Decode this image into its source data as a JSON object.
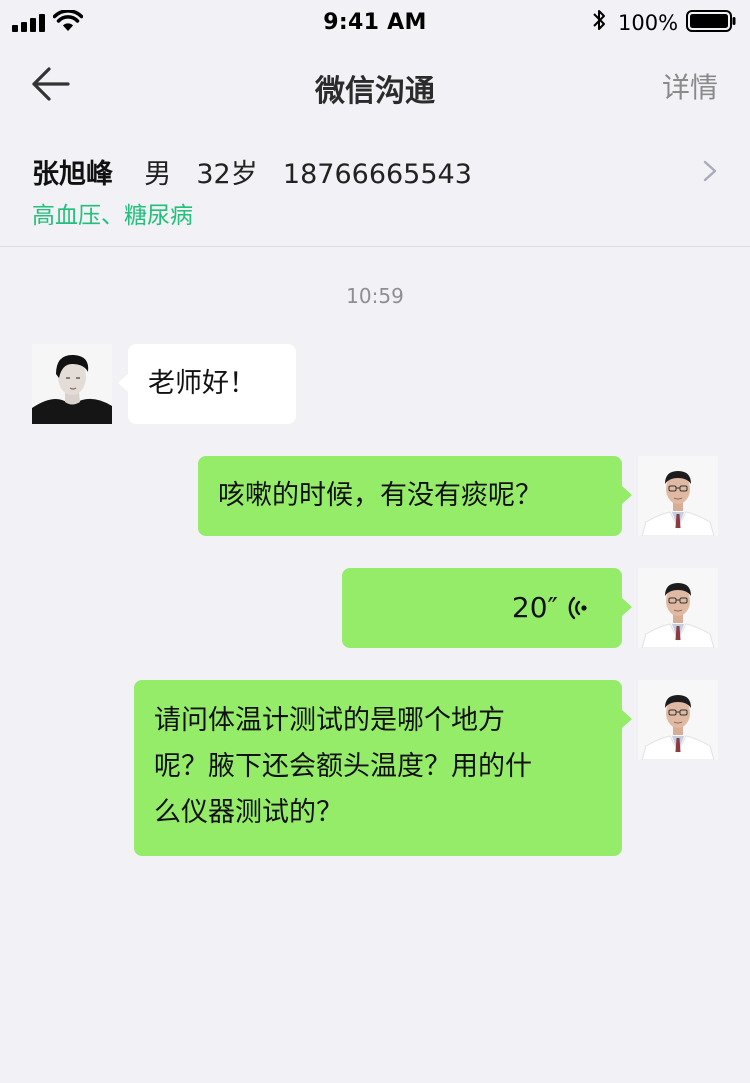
{
  "status_bar": {
    "time": "9:41 AM",
    "battery_percent": "100%",
    "battery_level": 1.0
  },
  "nav": {
    "title": "微信沟通",
    "detail_label": "详情"
  },
  "patient": {
    "name": "张旭峰",
    "gender": "男",
    "age": "32岁",
    "phone": "18766665543",
    "conditions": "高血压、糖尿病",
    "tag_color": "#23c07b"
  },
  "chat": {
    "timestamp": "10:59",
    "messages": [
      {
        "sender": "patient",
        "type": "text",
        "text": "老师好！"
      },
      {
        "sender": "doctor",
        "type": "text",
        "text": "咳嗽的时候，有没有痰呢？"
      },
      {
        "sender": "doctor",
        "type": "voice",
        "duration": "20″"
      },
      {
        "sender": "doctor",
        "type": "text",
        "lines": [
          "请问体温计测试的是哪个地方",
          "呢？腋下还会额头温度？用的什",
          "么仪器测试的？"
        ]
      }
    ]
  },
  "colors": {
    "background": "#f1f1f6",
    "outgoing_bubble": "#95ec69",
    "incoming_bubble": "#ffffff"
  },
  "icons": {
    "back": "back-arrow-icon",
    "chevron": "chevron-right-icon",
    "voice": "voice-wave-icon"
  }
}
